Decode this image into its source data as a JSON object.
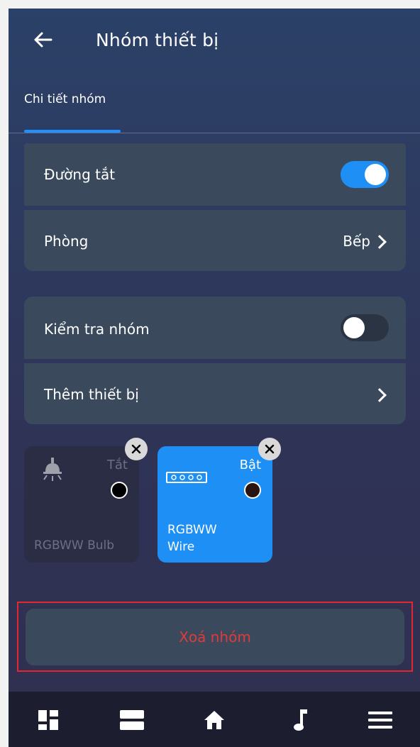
{
  "header": {
    "title": "Nhóm thiết bị",
    "back_icon": "arrow-left-icon"
  },
  "tabs": [
    {
      "label": "Chi tiết nhóm",
      "active": true
    }
  ],
  "settings": {
    "shortcut": {
      "label": "Đường tắt",
      "enabled": true
    },
    "room": {
      "label": "Phòng",
      "value": "Bếp"
    },
    "check_group": {
      "label": "Kiểm tra nhóm",
      "enabled": false
    },
    "add_device": {
      "label": "Thêm thiết bị"
    }
  },
  "devices": [
    {
      "name": "RGBWW Bulb",
      "state": "Tắt",
      "on": false,
      "icon": "ceiling-lamp-icon"
    },
    {
      "name": "RGBWW Wire",
      "name_line1": "RGBWW",
      "name_line2": "Wire",
      "state": "Bật",
      "on": true,
      "icon": "led-strip-icon"
    }
  ],
  "delete_button": {
    "label": "Xoá nhóm"
  },
  "bottom_nav": [
    {
      "icon": "dashboard-icon"
    },
    {
      "icon": "list-icon"
    },
    {
      "icon": "home-icon"
    },
    {
      "icon": "music-note-icon"
    },
    {
      "icon": "menu-icon"
    }
  ],
  "colors": {
    "accent": "#1e8ff5",
    "danger": "#e03a3a",
    "card": "#3a4a5c"
  }
}
